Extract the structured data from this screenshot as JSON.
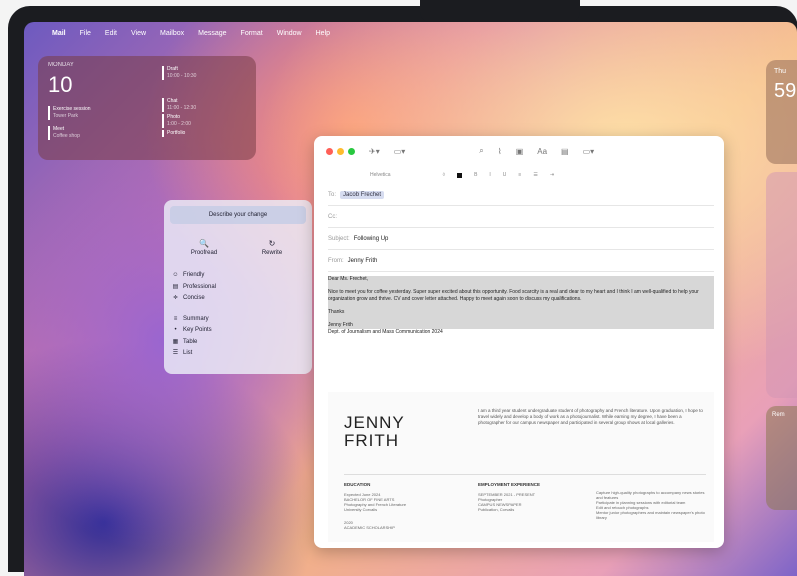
{
  "menubar": {
    "app": "Mail",
    "items": [
      "File",
      "Edit",
      "View",
      "Mailbox",
      "Message",
      "Format",
      "Window",
      "Help"
    ]
  },
  "calendar_widget": {
    "day": "MONDAY",
    "date": "10",
    "events": [
      {
        "title": "Exercise session",
        "sub": "Tower Park"
      },
      {
        "title": "Meet",
        "sub": "Coffee shop"
      },
      {
        "title": "Draft",
        "sub": "10:00 - 10:30"
      },
      {
        "title": "Chat",
        "sub": "11:00 - 12:30"
      },
      {
        "title": "Photo",
        "sub": "1:00 - 2:00"
      },
      {
        "title": "Portfolio",
        "sub": ""
      }
    ]
  },
  "weather_widget": {
    "title": "Thu",
    "temp": "59"
  },
  "reminders_widget": {
    "title": "Rem"
  },
  "writing_tools": {
    "header": "Describe your change",
    "buttons": [
      {
        "icon": "🔍",
        "label": "Proofread"
      },
      {
        "icon": "↻",
        "label": "Rewrite"
      }
    ],
    "items": [
      {
        "icon": "☺",
        "label": "Friendly"
      },
      {
        "icon": "▤",
        "label": "Professional"
      },
      {
        "icon": "≑",
        "label": "Concise"
      },
      {
        "icon": "≡",
        "label": "Summary"
      },
      {
        "icon": "•",
        "label": "Key Points"
      },
      {
        "icon": "▦",
        "label": "Table"
      },
      {
        "icon": "☰",
        "label": "List"
      }
    ]
  },
  "mail": {
    "to_label": "To:",
    "to_value": "Jacob Frechet",
    "cc_label": "Cc:",
    "subject_label": "Subject:",
    "subject_value": "Following Up",
    "from_label": "From:",
    "from_value": "Jenny Frith",
    "font": "Helvetica",
    "greeting": "Dear Ms. Frechet,",
    "paragraph": "Nice to meet you for coffee yesterday. Super super excited about this opportunity. Food scarcity is a real and dear to my heart and I think I am well-qualified to help your organization grow and thrive. CV and cover letter attached. Happy to meet again soon to discuss my qualifications.",
    "closing": "Thanks",
    "sig_name": "Jenny Frith",
    "sig_dept": "Dept. of Journalism and Mass Communication 2024"
  },
  "resume": {
    "first": "JENNY",
    "last": "FRITH",
    "bio": "I am a third year student undergraduate student of photography and French literature. Upon graduation, I hope to travel widely and develop a body of work as a photojournalist. While earning my degree, I have been a photographer for our campus newspaper and participated in several group shows at local galleries.",
    "education_h": "EDUCATION",
    "education_t": "Expected June 2024\nBACHELOR OF FINE ARTS\nPhotography and French Literature\nUniversity Corvalis",
    "education_t2": "2020\nACADEMIC SCHOLARSHIP",
    "employment_h": "EMPLOYMENT EXPERIENCE",
    "employment_t": "SEPTEMBER 2021 - PRESENT\nPhotographer\nCAMPUS NEWSPAPER\nPublication, Corvalis",
    "bullets": [
      "Capture high-quality photographs to accompany news stories and features",
      "Participate in planning sessions with editorial team",
      "Edit and retouch photographs",
      "Mentor junior photographers and maintain newspaper's photo library"
    ]
  }
}
